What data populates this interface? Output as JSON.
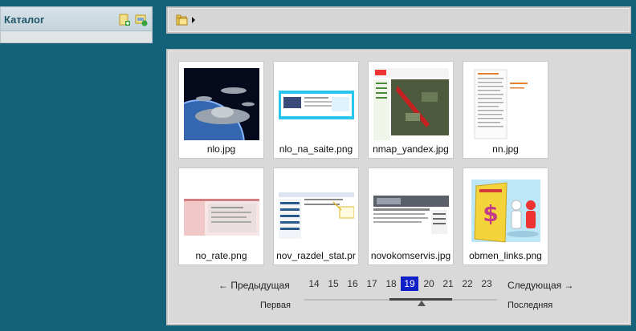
{
  "catalog": {
    "title": "Каталог",
    "add_icon": "add-folder-icon",
    "refresh_icon": "refresh-icon"
  },
  "toolbar": {
    "folder_icon": "folder-icon",
    "arrow_icon": "caret-right-icon"
  },
  "thumbnails": [
    {
      "name": "nlo.jpg",
      "image": "ufo-space-image"
    },
    {
      "name": "nlo_na_saite.png",
      "image": "website-screenshot"
    },
    {
      "name": "nmap_yandex.jpg",
      "image": "yandex-map-screenshot"
    },
    {
      "name": "nn.jpg",
      "image": "document-screenshot"
    },
    {
      "name": "no_rate.png",
      "image": "rate-table-screenshot"
    },
    {
      "name": "nov_razdel_stat.pr",
      "image": "new-section-screenshot"
    },
    {
      "name": "novokomservis.jpg",
      "image": "company-site-screenshot"
    },
    {
      "name": "obmen_links.png",
      "image": "link-exchange-image"
    }
  ],
  "pager": {
    "prev": "← Предыдущая",
    "next": "Следующая →",
    "first": "Первая",
    "last": "Последняя",
    "pages": [
      "14",
      "15",
      "16",
      "17",
      "18",
      "19",
      "20",
      "21",
      "22",
      "23"
    ],
    "current": "19"
  },
  "colors": {
    "background": "#13627a",
    "active_page": "#1020c8"
  }
}
